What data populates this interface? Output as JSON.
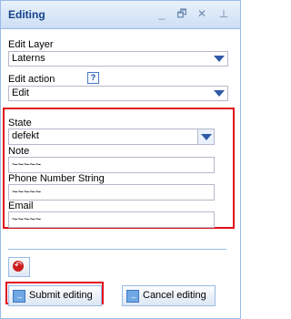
{
  "window": {
    "title": "Editing",
    "tools": {
      "minimize": "_",
      "restore": "🗗",
      "close": "✕",
      "pin": "⊥"
    }
  },
  "edit_layer": {
    "label": "Edit Layer",
    "value": "Laterns"
  },
  "edit_action": {
    "label": "Edit action",
    "help": "?",
    "value": "Edit"
  },
  "form": {
    "state": {
      "label": "State",
      "value": "defekt"
    },
    "note": {
      "label": "Note",
      "value": "~~~~~"
    },
    "phone": {
      "label": "Phone Number String",
      "value": "~~~~~"
    },
    "email": {
      "label": "Email",
      "value": "~~~~~"
    }
  },
  "buttons": {
    "undo_icon": "↶",
    "submit_label": "Submit editing",
    "cancel_label": "Cancel editing",
    "arrow_icon": "→"
  },
  "colors": {
    "highlight": "#e0101a",
    "accent": "#15428b",
    "border": "#99bbe8"
  }
}
